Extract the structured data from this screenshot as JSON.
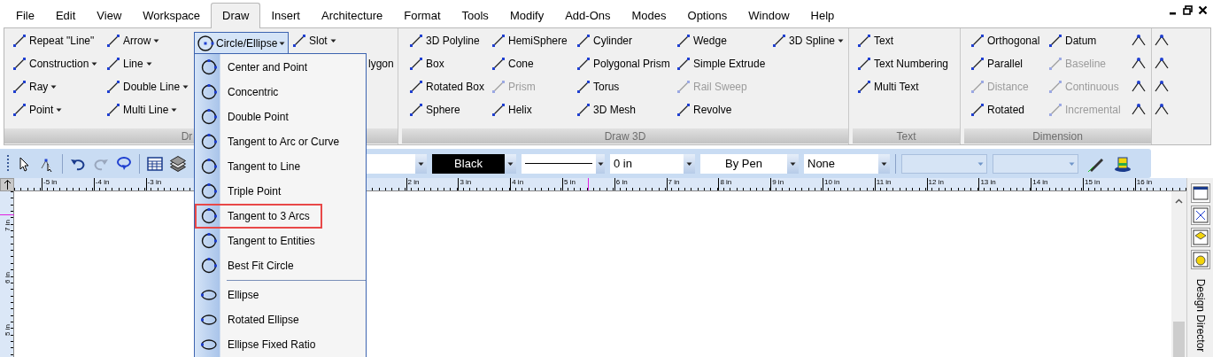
{
  "menu_bar": {
    "tabs": [
      {
        "label": "File",
        "selected": false
      },
      {
        "label": "Edit",
        "selected": false
      },
      {
        "label": "View",
        "selected": false
      },
      {
        "label": "Workspace",
        "selected": false
      },
      {
        "label": "Draw",
        "selected": true
      },
      {
        "label": "Insert",
        "selected": false
      },
      {
        "label": "Architecture",
        "selected": false
      },
      {
        "label": "Format",
        "selected": false
      },
      {
        "label": "Tools",
        "selected": false
      },
      {
        "label": "Modify",
        "selected": false
      },
      {
        "label": "Add-Ons",
        "selected": false
      },
      {
        "label": "Modes",
        "selected": false
      },
      {
        "label": "Options",
        "selected": false
      },
      {
        "label": "Window",
        "selected": false
      },
      {
        "label": "Help",
        "selected": false
      }
    ]
  },
  "ribbon": {
    "groups": [
      {
        "label": "Dr",
        "columns": [
          {
            "kind": "tools",
            "items": [
              {
                "label": "Repeat \"Line\"",
                "dropdown": false,
                "disabled": false
              },
              {
                "label": "Construction",
                "dropdown": true,
                "disabled": false
              },
              {
                "label": "Ray",
                "dropdown": true,
                "disabled": false
              },
              {
                "label": "Point",
                "dropdown": true,
                "disabled": false
              }
            ]
          },
          {
            "kind": "tools",
            "items": [
              {
                "label": "Arrow",
                "dropdown": true,
                "disabled": false
              },
              {
                "label": "Line",
                "dropdown": true,
                "disabled": false
              },
              {
                "label": "Double Line",
                "dropdown": true,
                "disabled": false
              },
              {
                "label": "Multi Line",
                "dropdown": true,
                "disabled": false
              }
            ]
          },
          {
            "kind": "menu",
            "label": "Circle/Ellipse",
            "sections": [
              [
                {
                  "label": "Center and Point",
                  "selected": false
                },
                {
                  "label": "Concentric",
                  "selected": false
                },
                {
                  "label": "Double Point",
                  "selected": false
                },
                {
                  "label": "Tangent to Arc or Curve",
                  "selected": false
                },
                {
                  "label": "Tangent to Line",
                  "selected": false
                },
                {
                  "label": "Triple Point",
                  "selected": false
                },
                {
                  "label": "Tangent to 3 Arcs",
                  "selected": true
                },
                {
                  "label": "Tangent to Entities",
                  "selected": false
                },
                {
                  "label": "Best Fit Circle",
                  "selected": false
                }
              ],
              [
                {
                  "label": "Ellipse",
                  "selected": false
                },
                {
                  "label": "Rotated Ellipse",
                  "selected": false
                },
                {
                  "label": "Ellipse Fixed Ratio",
                  "selected": false
                }
              ]
            ]
          },
          {
            "kind": "tools",
            "items": [
              {
                "label": "Slot",
                "dropdown": true,
                "disabled": false
              },
              {
                "label": "lygon",
                "kind": "cut"
              }
            ]
          }
        ]
      },
      {
        "label": "Draw 3D",
        "columns": [
          {
            "kind": "tools",
            "items": [
              {
                "label": "3D Polyline",
                "dropdown": false,
                "disabled": false
              },
              {
                "label": "Box",
                "dropdown": false,
                "disabled": false
              },
              {
                "label": "Rotated Box",
                "dropdown": false,
                "disabled": false
              },
              {
                "label": "Sphere",
                "dropdown": false,
                "disabled": false
              }
            ]
          },
          {
            "kind": "tools",
            "items": [
              {
                "label": "HemiSphere",
                "dropdown": false,
                "disabled": false
              },
              {
                "label": "Cone",
                "dropdown": false,
                "disabled": false
              },
              {
                "label": "Prism",
                "dropdown": false,
                "disabled": true
              },
              {
                "label": "Helix",
                "dropdown": false,
                "disabled": false
              }
            ]
          },
          {
            "kind": "tools",
            "items": [
              {
                "label": "Cylinder",
                "dropdown": false,
                "disabled": false
              },
              {
                "label": "Polygonal Prism",
                "dropdown": false,
                "disabled": false
              },
              {
                "label": "Torus",
                "dropdown": false,
                "disabled": false
              },
              {
                "label": "3D Mesh",
                "dropdown": false,
                "disabled": false
              }
            ]
          },
          {
            "kind": "tools",
            "items": [
              {
                "label": "Wedge",
                "dropdown": false,
                "disabled": false
              },
              {
                "label": "Simple Extrude",
                "dropdown": false,
                "disabled": false
              },
              {
                "label": "Rail Sweep",
                "dropdown": false,
                "disabled": true
              },
              {
                "label": "Revolve",
                "dropdown": false,
                "disabled": false
              }
            ]
          },
          {
            "kind": "tools",
            "items": [
              {
                "label": "3D Spline",
                "dropdown": true,
                "disabled": false
              }
            ]
          }
        ]
      },
      {
        "label": "Text",
        "columns": [
          {
            "kind": "tools",
            "items": [
              {
                "label": "Text",
                "dropdown": false,
                "disabled": false
              },
              {
                "label": "Text Numbering",
                "dropdown": false,
                "disabled": false
              },
              {
                "label": "Multi Text",
                "dropdown": false,
                "disabled": false
              }
            ]
          }
        ]
      },
      {
        "label": "Dimension",
        "columns": [
          {
            "kind": "tools",
            "items": [
              {
                "label": "Orthogonal",
                "dropdown": false,
                "disabled": false
              },
              {
                "label": "Parallel",
                "dropdown": false,
                "disabled": false
              },
              {
                "label": "Distance",
                "dropdown": false,
                "disabled": true
              },
              {
                "label": "Rotated",
                "dropdown": false,
                "disabled": false
              }
            ]
          },
          {
            "kind": "tools",
            "items": [
              {
                "label": "Datum",
                "dropdown": false,
                "disabled": false
              },
              {
                "label": "Baseline",
                "dropdown": false,
                "disabled": true
              },
              {
                "label": "Continuous",
                "dropdown": false,
                "disabled": true
              },
              {
                "label": "Incremental",
                "dropdown": false,
                "disabled": true
              }
            ]
          },
          {
            "kind": "icon_grid"
          }
        ]
      }
    ]
  },
  "toolbar": {
    "combos": [
      {
        "kind": "empty"
      },
      {
        "kind": "color",
        "value": "Black"
      },
      {
        "kind": "line"
      },
      {
        "kind": "text",
        "value": "0 in"
      },
      {
        "kind": "centered_text",
        "value": "By Pen"
      },
      {
        "kind": "text",
        "value": "None"
      },
      {
        "kind": "flat"
      },
      {
        "kind": "flat"
      }
    ]
  },
  "ruler": {
    "horizontal": [
      "-5 in",
      "-4 in",
      "-3 in",
      "2 in",
      "3 in",
      "4 in",
      "5 in",
      "6 in",
      "7 in",
      "8 in",
      "9 in",
      "10 in",
      "11 in",
      "12 in",
      "13 in",
      "14 in",
      "15 in",
      "16 in"
    ],
    "vertical": [
      "7 in",
      "6 in",
      "5 in"
    ]
  },
  "side_panel": {
    "title": "Design Director"
  }
}
